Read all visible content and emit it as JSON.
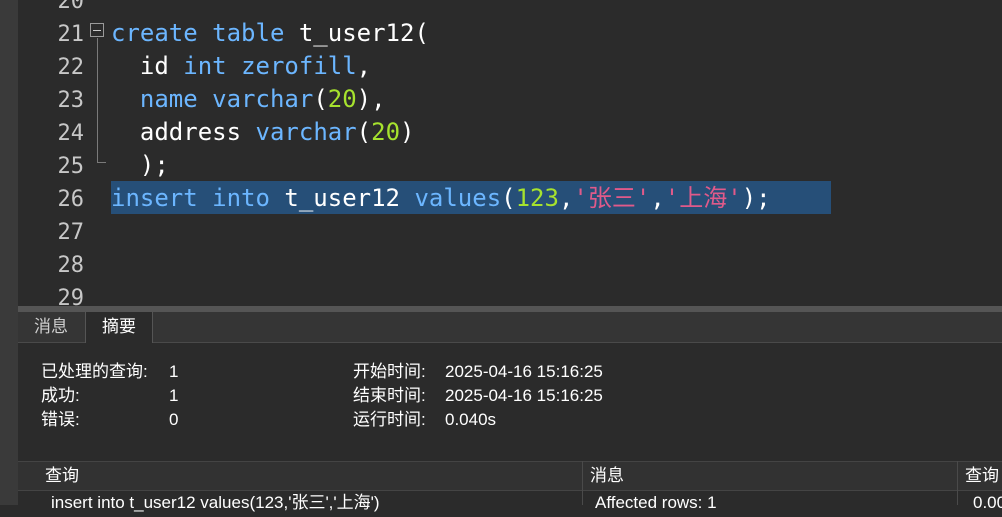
{
  "editor": {
    "line_numbers": [
      "20",
      "21",
      "22",
      "23",
      "24",
      "25",
      "26",
      "27",
      "28",
      "29"
    ],
    "lines": {
      "l21": {
        "kw1": "create",
        "kw2": "table",
        "name": "t_user12("
      },
      "l22": {
        "col": "id",
        "kw1": "int",
        "kw2": "zerofill",
        "end": ","
      },
      "l23": {
        "col": "name",
        "kw": "varchar",
        "open": "(",
        "num": "20",
        "end": "),"
      },
      "l24": {
        "col": "address",
        "kw": "varchar",
        "open": "(",
        "num": "20",
        "end": ")"
      },
      "l25": {
        "text": ");"
      },
      "l26": {
        "kw1": "insert",
        "kw2": "into",
        "name": "t_user12",
        "kw3": "values",
        "open": "(",
        "num": "123",
        "comma1": ",",
        "str1": "'张三'",
        "comma2": ",",
        "str2": "'上海'",
        "end": ");"
      }
    }
  },
  "tabs": [
    {
      "label": "消息",
      "active": false
    },
    {
      "label": "摘要",
      "active": true
    }
  ],
  "summary": {
    "processed_label": "已处理的查询:",
    "processed_value": "1",
    "success_label": "成功:",
    "success_value": "1",
    "error_label": "错误:",
    "error_value": "0",
    "start_label": "开始时间:",
    "start_value": "2025-04-16 15:16:25",
    "end_label": "结束时间:",
    "end_value": "2025-04-16 15:16:25",
    "runtime_label": "运行时间:",
    "runtime_value": "0.040s"
  },
  "results": {
    "columns": [
      "查询",
      "消息",
      "查询"
    ],
    "rows": [
      {
        "query": "insert into t_user12 values(123,'张三','上海')",
        "message": "Affected rows: 1",
        "time": "0.00"
      }
    ]
  },
  "colors": {
    "keyword": "#6cb6ff",
    "number": "#a6e22e",
    "string": "#e05a8a",
    "selection": "#264f78",
    "background": "#2b2b2b"
  }
}
